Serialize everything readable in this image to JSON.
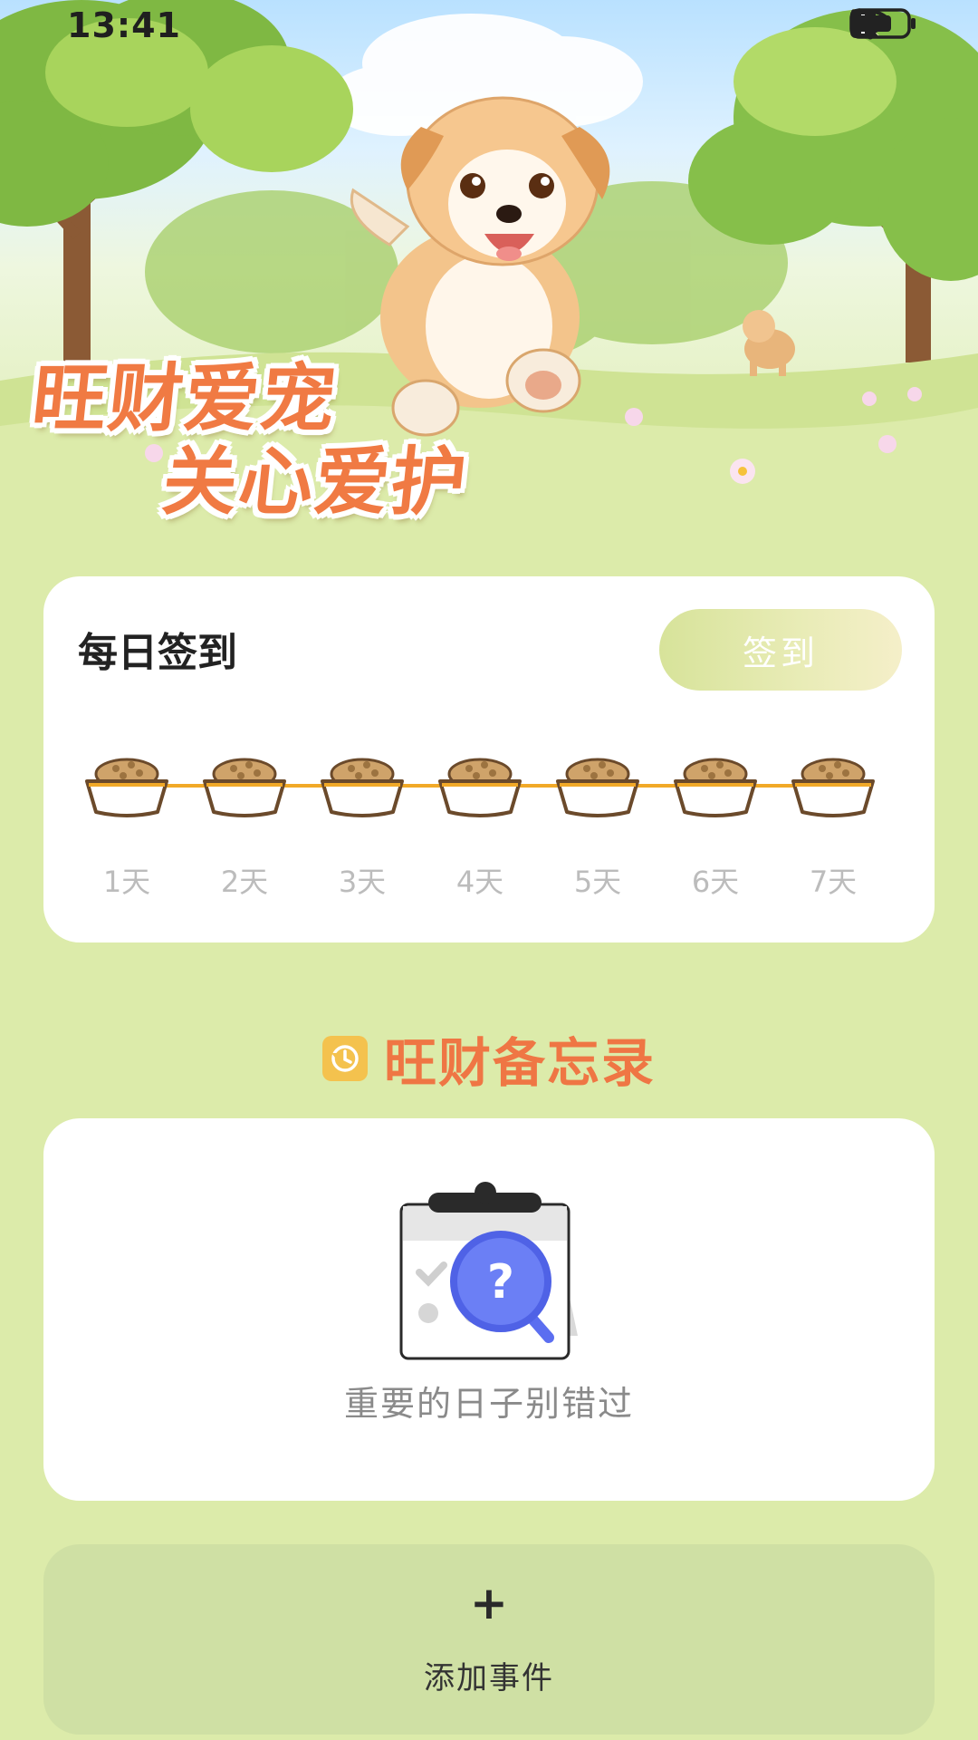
{
  "status_bar": {
    "time": "13:41",
    "icons": [
      "bluetooth-icon",
      "mute-bell-icon",
      "wifi-icon",
      "alert-icon",
      "battery-icon"
    ]
  },
  "banner": {
    "slogan_line1": "旺财爱宠",
    "slogan_line2": "关心爱护"
  },
  "checkin": {
    "title": "每日签到",
    "button_label": "签到",
    "days": [
      "1天",
      "2天",
      "3天",
      "4天",
      "5天",
      "6天",
      "7天"
    ]
  },
  "memo": {
    "title": "旺财备忘录",
    "empty_text": "重要的日子别错过"
  },
  "add_event": {
    "plus": "+",
    "label": "添加事件"
  },
  "colors": {
    "page_bg": "#dcebaa",
    "accent_orange": "#ef7644",
    "track_orange": "#f1a928",
    "add_button_bg": "#cfe0a4"
  }
}
